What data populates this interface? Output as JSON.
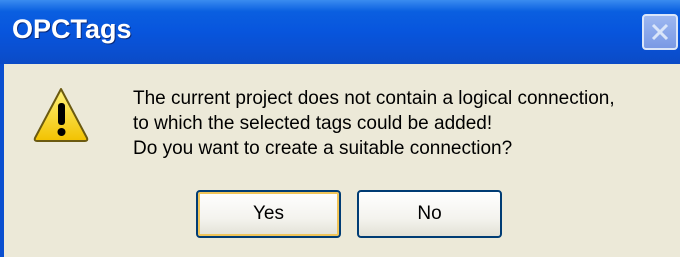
{
  "window": {
    "title": "OPCTags"
  },
  "dialog": {
    "icon": "warning-icon",
    "message_lines": [
      "The current project does not contain a logical connection,",
      "to which the selected tags could be added!",
      "Do you want to create a suitable connection?"
    ],
    "buttons": {
      "yes_label": "Yes",
      "no_label": "No"
    }
  },
  "colors": {
    "titlebar": "#0855dd",
    "dialog_background": "#ece9d8",
    "warning_yellow": "#f7d21c"
  }
}
